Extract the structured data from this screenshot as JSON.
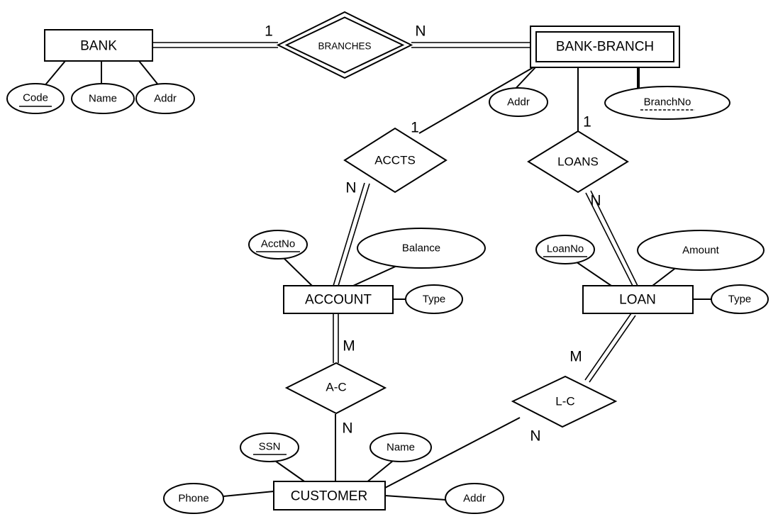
{
  "diagram": {
    "title": "Bank ER Diagram",
    "notation": "chen",
    "background_color": "#ffffff",
    "line_color": "#000000"
  },
  "entities": [
    {
      "id": "bank",
      "label": "BANK",
      "kind": "strong",
      "attributes": [
        {
          "label": "Code",
          "key": "primary"
        },
        {
          "label": "Name",
          "key": "none"
        },
        {
          "label": "Addr",
          "key": "none"
        }
      ]
    },
    {
      "id": "bank-branch",
      "label": "BANK-BRANCH",
      "kind": "weak",
      "attributes": [
        {
          "label": "Addr",
          "key": "none"
        },
        {
          "label": "BranchNo",
          "key": "partial"
        }
      ]
    },
    {
      "id": "account",
      "label": "ACCOUNT",
      "kind": "strong",
      "attributes": [
        {
          "label": "AcctNo",
          "key": "primary"
        },
        {
          "label": "Balance",
          "key": "none"
        },
        {
          "label": "Type",
          "key": "none"
        }
      ]
    },
    {
      "id": "loan",
      "label": "LOAN",
      "kind": "strong",
      "attributes": [
        {
          "label": "LoanNo",
          "key": "primary"
        },
        {
          "label": "Amount",
          "key": "none"
        },
        {
          "label": "Type",
          "key": "none"
        }
      ]
    },
    {
      "id": "customer",
      "label": "CUSTOMER",
      "kind": "strong",
      "attributes": [
        {
          "label": "SSN",
          "key": "primary"
        },
        {
          "label": "Name",
          "key": "none"
        },
        {
          "label": "Phone",
          "key": "none"
        },
        {
          "label": "Addr",
          "key": "none"
        }
      ]
    }
  ],
  "relationships": [
    {
      "id": "branches",
      "label": "BRANCHES",
      "kind": "identifying",
      "from": "BANK",
      "to": "BANK-BRANCH",
      "from_cardinality": "1",
      "to_cardinality": "N"
    },
    {
      "id": "accts",
      "label": "ACCTS",
      "kind": "regular",
      "from": "BANK-BRANCH",
      "to": "ACCOUNT",
      "from_cardinality": "1",
      "to_cardinality": "N"
    },
    {
      "id": "loans",
      "label": "LOANS",
      "kind": "regular",
      "from": "BANK-BRANCH",
      "to": "LOAN",
      "from_cardinality": "1",
      "to_cardinality": "N"
    },
    {
      "id": "a-c",
      "label": "A-C",
      "kind": "regular",
      "from": "ACCOUNT",
      "to": "CUSTOMER",
      "from_cardinality": "M",
      "to_cardinality": "N"
    },
    {
      "id": "l-c",
      "label": "L-C",
      "kind": "regular",
      "from": "LOAN",
      "to": "CUSTOMER",
      "from_cardinality": "M",
      "to_cardinality": "N"
    }
  ],
  "labels": {
    "bank": "BANK",
    "bank_branch": "BANK-BRANCH",
    "account": "ACCOUNT",
    "loan": "LOAN",
    "customer": "CUSTOMER",
    "branches": "BRANCHES",
    "accts": "ACCTS",
    "loans": "LOANS",
    "a_c": "A-C",
    "l_c": "L-C",
    "attr_bank_code": "Code",
    "attr_bank_name": "Name",
    "attr_bank_addr": "Addr",
    "attr_branch_addr": "Addr",
    "attr_branch_no": "BranchNo",
    "attr_acct_no": "AcctNo",
    "attr_acct_balance": "Balance",
    "attr_acct_type": "Type",
    "attr_loan_no": "LoanNo",
    "attr_loan_amount": "Amount",
    "attr_loan_type": "Type",
    "attr_cust_ssn": "SSN",
    "attr_cust_name": "Name",
    "attr_cust_phone": "Phone",
    "attr_cust_addr": "Addr",
    "card_branches_1": "1",
    "card_branches_n": "N",
    "card_accts_1": "1",
    "card_accts_n": "N",
    "card_loans_1": "1",
    "card_loans_n": "N",
    "card_ac_m": "M",
    "card_ac_n": "N",
    "card_lc_m": "M",
    "card_lc_n": "N"
  }
}
